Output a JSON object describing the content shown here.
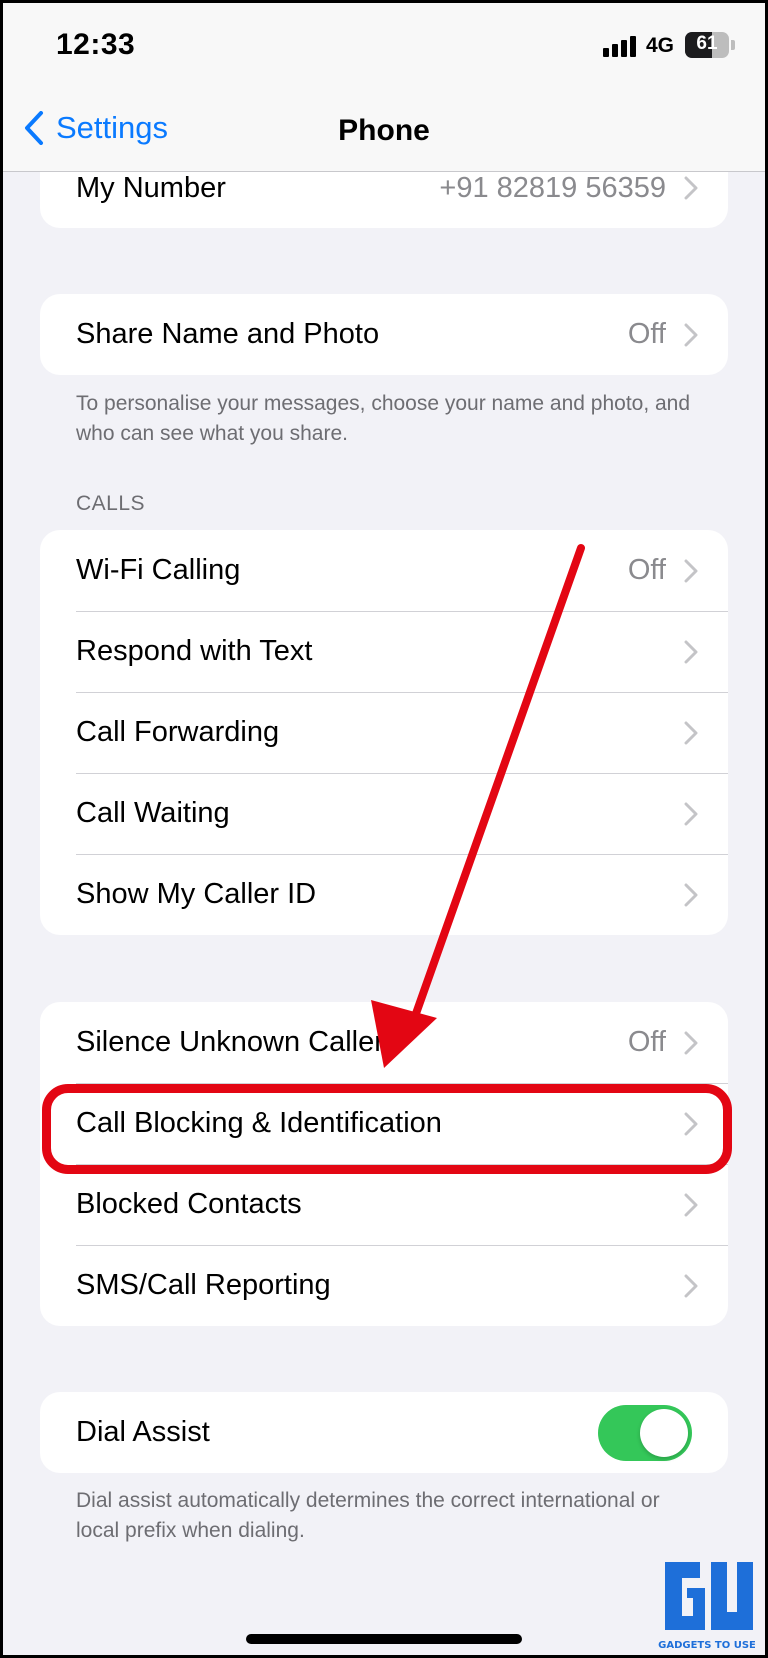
{
  "status_bar": {
    "time": "12:33",
    "network": "4G",
    "battery": "61",
    "battery_level": 0.61
  },
  "nav": {
    "back_label": "Settings",
    "title": "Phone"
  },
  "my_number": {
    "label": "My Number",
    "value": "+91 82819 56359"
  },
  "share_section": {
    "label": "Share Name and Photo",
    "value": "Off",
    "footnote": "To personalise your messages, choose your name and photo, and who can see what you share."
  },
  "calls_section": {
    "header": "CALLS",
    "items": [
      {
        "label": "Wi-Fi Calling",
        "value": "Off"
      },
      {
        "label": "Respond with Text",
        "value": ""
      },
      {
        "label": "Call Forwarding",
        "value": ""
      },
      {
        "label": "Call Waiting",
        "value": ""
      },
      {
        "label": "Show My Caller ID",
        "value": ""
      }
    ]
  },
  "blocking_section": {
    "items": [
      {
        "label": "Silence Unknown Callers",
        "value": "Off"
      },
      {
        "label": "Call Blocking & Identification",
        "value": ""
      },
      {
        "label": "Blocked Contacts",
        "value": ""
      },
      {
        "label": "SMS/Call Reporting",
        "value": ""
      }
    ]
  },
  "dial_assist": {
    "label": "Dial Assist",
    "enabled": true,
    "footnote": "Dial assist automatically determines the correct international or local prefix when dialing."
  },
  "watermark": {
    "text": "GADGETS TO USE"
  },
  "colors": {
    "accent": "#0a7aff",
    "toggle_on": "#34c759",
    "annotation": "#e30613"
  },
  "icons": {
    "back": "chevron-left-icon",
    "row": "chevron-right-icon",
    "signal": "cellular-signal-icon",
    "battery": "battery-icon"
  }
}
